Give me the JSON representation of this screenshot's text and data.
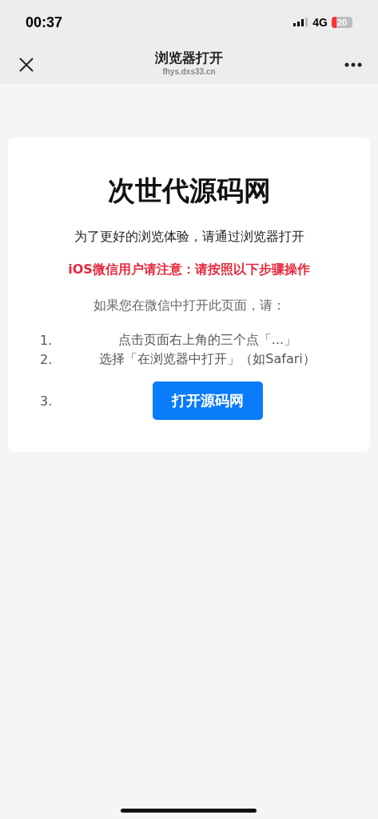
{
  "status_bar": {
    "time": "00:37",
    "network": "4G",
    "battery": "20"
  },
  "nav": {
    "title": "浏览器打开",
    "url": "fhys.dxs33.cn"
  },
  "card": {
    "title": "次世代源码网",
    "subtitle": "为了更好的浏览体验，请通过浏览器打开",
    "warning": "iOS微信用户请注意：请按照以下步骤操作",
    "intro": "如果您在微信中打开此页面，请：",
    "steps": [
      {
        "number": "1.",
        "kind": "text",
        "text": "点击页面右上角的三个点「...」"
      },
      {
        "number": "2.",
        "kind": "text",
        "text": "选择「在浏览器中打开」（如Safari）"
      },
      {
        "number": "3.",
        "kind": "button",
        "text": "打开源码网"
      }
    ]
  }
}
